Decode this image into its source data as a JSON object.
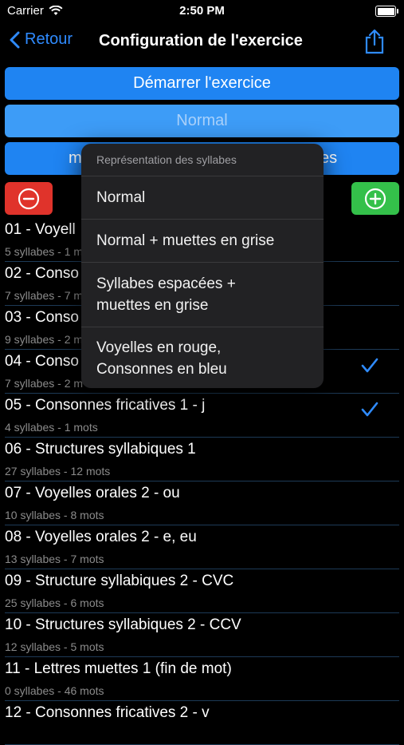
{
  "status": {
    "carrier": "Carrier",
    "time": "2:50 PM"
  },
  "nav": {
    "back_label": "Retour",
    "title": "Configuration de l'exercice"
  },
  "buttons": {
    "start_label": "Démarrer l'exercice",
    "mode_label": "Normal",
    "third_left": "m",
    "third_right": "es"
  },
  "list": [
    {
      "title": "01 - Voyell",
      "subtitle": "5 syllabes - 1 m",
      "checked": false
    },
    {
      "title": "02 - Conso",
      "subtitle": "7 syllabes - 7 m",
      "checked": false
    },
    {
      "title": "03 - Conso",
      "subtitle": "9 syllabes - 2 m",
      "checked": false
    },
    {
      "title": "04 - Conso",
      "subtitle": "7 syllabes - 2 m",
      "checked": true
    },
    {
      "title": "05 - Consonnes fricatives 1 - j",
      "subtitle": "4 syllabes - 1 mots",
      "checked": true
    },
    {
      "title": "06 - Structures syllabiques 1",
      "subtitle": "27 syllabes - 12 mots",
      "checked": false
    },
    {
      "title": "07 - Voyelles orales 2 - ou",
      "subtitle": "10 syllabes - 8 mots",
      "checked": false
    },
    {
      "title": "08 - Voyelles orales 2 - e, eu",
      "subtitle": "13 syllabes - 7 mots",
      "checked": false
    },
    {
      "title": "09 - Structure syllabiques 2 - CVC",
      "subtitle": "25 syllabes - 6 mots",
      "checked": false
    },
    {
      "title": "10 - Structures syllabiques 2 - CCV",
      "subtitle": "12 syllabes - 5 mots",
      "checked": false
    },
    {
      "title": "11 - Lettres muettes 1 (fin de mot)",
      "subtitle": "0 syllabes - 46 mots",
      "checked": false
    },
    {
      "title": "12 - Consonnes fricatives 2 - v",
      "subtitle": "",
      "checked": false
    }
  ],
  "popover": {
    "header": "Représentation des syllabes",
    "items": [
      {
        "line1": "Normal",
        "line2": ""
      },
      {
        "line1": "Normal + muettes en grise",
        "line2": ""
      },
      {
        "line1": "Syllabes espacées +",
        "line2": "muettes en grise"
      },
      {
        "line1": "Voyelles en rouge,",
        "line2": "Consonnes en bleu"
      }
    ]
  },
  "colors": {
    "accent": "#1f84f2",
    "remove": "#e0332b",
    "add": "#34c04a",
    "checkmark": "#2f8bff"
  }
}
